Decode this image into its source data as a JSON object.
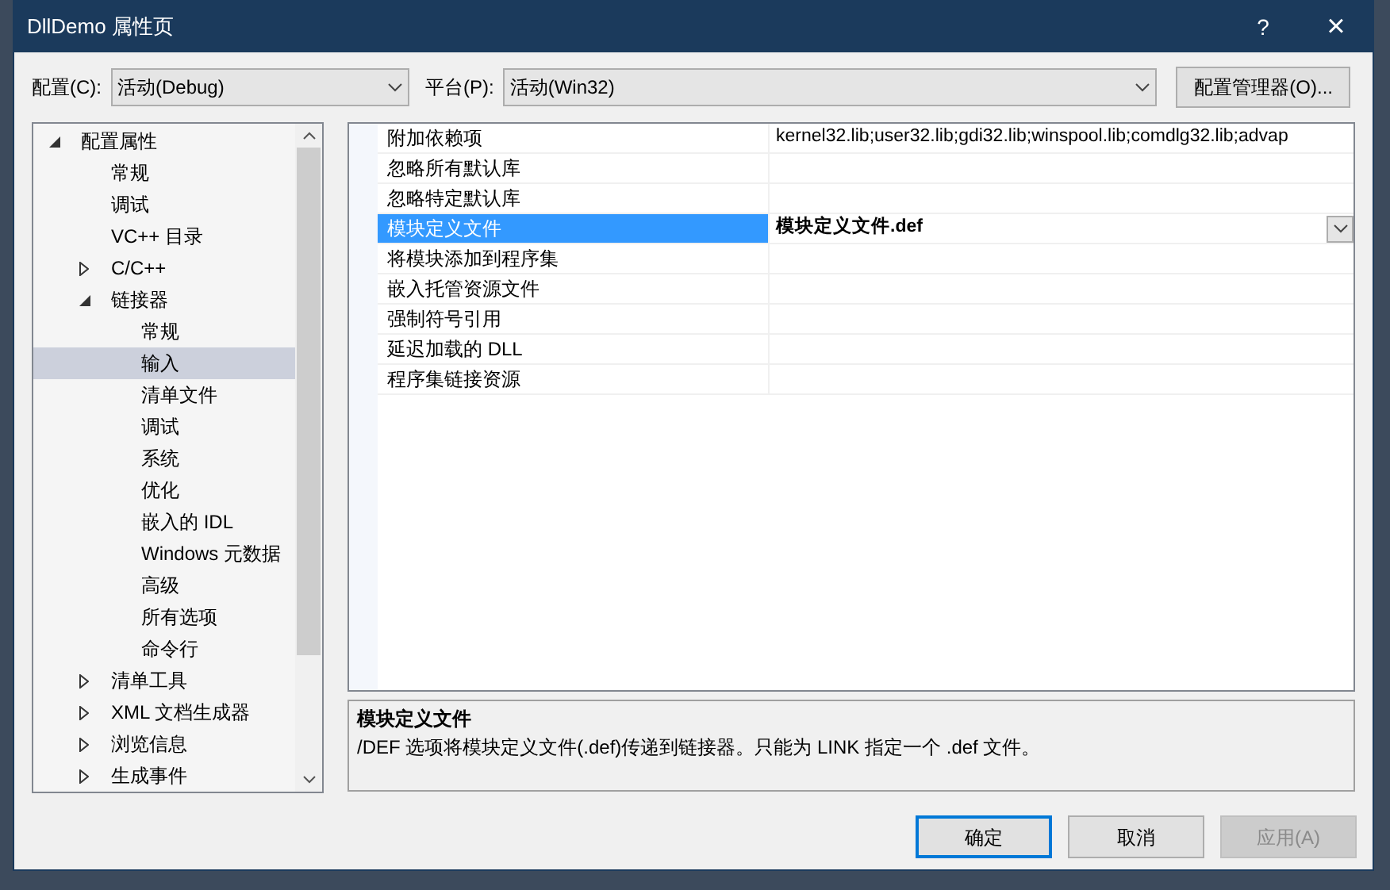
{
  "window": {
    "title": "DllDemo 属性页",
    "help": "?",
    "close": "×"
  },
  "toolbar": {
    "config_label": "配置(C):",
    "config_value": "活动(Debug)",
    "platform_label": "平台(P):",
    "platform_value": "活动(Win32)",
    "manager_button": "配置管理器(O)..."
  },
  "tree": [
    {
      "label": "配置属性",
      "expanded": true,
      "selected": false,
      "children": [
        {
          "label": "常规",
          "selected": false
        },
        {
          "label": "调试",
          "selected": false
        },
        {
          "label": "VC++ 目录",
          "selected": false
        },
        {
          "label": "C/C++",
          "expanded": false,
          "selected": false
        },
        {
          "label": "链接器",
          "expanded": true,
          "selected": false,
          "children": [
            {
              "label": "常规",
              "selected": false
            },
            {
              "label": "输入",
              "selected": true
            },
            {
              "label": "清单文件",
              "selected": false
            },
            {
              "label": "调试",
              "selected": false
            },
            {
              "label": "系统",
              "selected": false
            },
            {
              "label": "优化",
              "selected": false
            },
            {
              "label": "嵌入的 IDL",
              "selected": false
            },
            {
              "label": "Windows 元数据",
              "selected": false
            },
            {
              "label": "高级",
              "selected": false
            },
            {
              "label": "所有选项",
              "selected": false
            },
            {
              "label": "命令行",
              "selected": false
            }
          ]
        },
        {
          "label": "清单工具",
          "expanded": false,
          "selected": false
        },
        {
          "label": "XML 文档生成器",
          "expanded": false,
          "selected": false
        },
        {
          "label": "浏览信息",
          "expanded": false,
          "selected": false
        },
        {
          "label": "生成事件",
          "expanded": false,
          "selected": false
        }
      ]
    }
  ],
  "properties": [
    {
      "name": "附加依赖项",
      "value": "kernel32.lib;user32.lib;gdi32.lib;winspool.lib;comdlg32.lib;advap",
      "selected": false
    },
    {
      "name": "忽略所有默认库",
      "selected": false
    },
    {
      "name": "忽略特定默认库",
      "selected": false
    },
    {
      "name": "模块定义文件",
      "value": "模块定义文件.def",
      "selected": true
    },
    {
      "name": "将模块添加到程序集",
      "selected": false
    },
    {
      "name": "嵌入托管资源文件",
      "selected": false
    },
    {
      "name": "强制符号引用",
      "selected": false
    },
    {
      "name": "延迟加载的 DLL",
      "selected": false
    },
    {
      "name": "程序集链接资源",
      "selected": false
    }
  ],
  "description": {
    "title": "模块定义文件",
    "text": "/DEF 选项将模块定义文件(.def)传递到链接器。只能为 LINK 指定一个 .def 文件。"
  },
  "buttons": [
    {
      "label": "确定",
      "kind": "default",
      "disabled": false
    },
    {
      "label": "取消",
      "kind": "normal",
      "disabled": false
    },
    {
      "label": "应用(A)",
      "kind": "normal",
      "disabled": true
    }
  ]
}
